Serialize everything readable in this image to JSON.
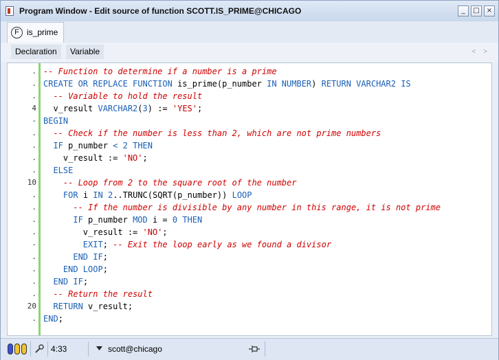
{
  "window": {
    "title": "Program Window - Edit source of function SCOTT.IS_PRIME@CHICAGO",
    "controls": {
      "minimize": "_",
      "maximize": "□",
      "close": "×"
    }
  },
  "tab": {
    "icon_letter": "F",
    "label": "is_prime"
  },
  "subtabs": [
    "Declaration",
    "Variable"
  ],
  "nav_arrows": "< >",
  "code_lines": [
    {
      "gutter": ".",
      "tokens": [
        {
          "t": "-- Function to determine if a number is a prime",
          "c": "cmt"
        }
      ]
    },
    {
      "gutter": ".",
      "tokens": [
        {
          "t": "CREATE OR REPLACE FUNCTION",
          "c": "kw"
        },
        {
          "t": " is_prime(p_number ",
          "c": ""
        },
        {
          "t": "IN NUMBER",
          "c": "kw"
        },
        {
          "t": ") ",
          "c": ""
        },
        {
          "t": "RETURN VARCHAR2 IS",
          "c": "kw"
        }
      ]
    },
    {
      "gutter": ".",
      "tokens": [
        {
          "t": "  ",
          "c": ""
        },
        {
          "t": "-- Variable to hold the result",
          "c": "cmt"
        }
      ]
    },
    {
      "gutter": "4",
      "tokens": [
        {
          "t": "  v_result ",
          "c": ""
        },
        {
          "t": "VARCHAR2",
          "c": "kw"
        },
        {
          "t": "(",
          "c": ""
        },
        {
          "t": "3",
          "c": "num"
        },
        {
          "t": ") := ",
          "c": ""
        },
        {
          "t": "'YES'",
          "c": "str"
        },
        {
          "t": ";",
          "c": ""
        }
      ]
    },
    {
      "gutter": "-",
      "tokens": [
        {
          "t": "BEGIN",
          "c": "kw"
        }
      ]
    },
    {
      "gutter": ".",
      "tokens": [
        {
          "t": "  ",
          "c": ""
        },
        {
          "t": "-- Check if the number is less than 2, which are not prime numbers",
          "c": "cmt"
        }
      ]
    },
    {
      "gutter": ".",
      "tokens": [
        {
          "t": "  ",
          "c": ""
        },
        {
          "t": "IF",
          "c": "kw"
        },
        {
          "t": " p_number ",
          "c": ""
        },
        {
          "t": "<",
          "c": "kw"
        },
        {
          "t": " ",
          "c": ""
        },
        {
          "t": "2",
          "c": "num"
        },
        {
          "t": " ",
          "c": ""
        },
        {
          "t": "THEN",
          "c": "kw"
        }
      ]
    },
    {
      "gutter": ".",
      "tokens": [
        {
          "t": "    v_result := ",
          "c": ""
        },
        {
          "t": "'NO'",
          "c": "str"
        },
        {
          "t": ";",
          "c": ""
        }
      ]
    },
    {
      "gutter": ".",
      "tokens": [
        {
          "t": "  ",
          "c": ""
        },
        {
          "t": "ELSE",
          "c": "kw"
        }
      ]
    },
    {
      "gutter": "10",
      "tokens": [
        {
          "t": "    ",
          "c": ""
        },
        {
          "t": "-- Loop from 2 to the square root of the number",
          "c": "cmt"
        }
      ]
    },
    {
      "gutter": ".",
      "tokens": [
        {
          "t": "    ",
          "c": ""
        },
        {
          "t": "FOR",
          "c": "kw"
        },
        {
          "t": " i ",
          "c": ""
        },
        {
          "t": "IN",
          "c": "kw"
        },
        {
          "t": " ",
          "c": ""
        },
        {
          "t": "2",
          "c": "num"
        },
        {
          "t": "..TRUNC(SQRT(p_number)) ",
          "c": ""
        },
        {
          "t": "LOOP",
          "c": "kw"
        }
      ]
    },
    {
      "gutter": ".",
      "tokens": [
        {
          "t": "      ",
          "c": ""
        },
        {
          "t": "-- If the number is divisible by any number in this range, it is not prime",
          "c": "cmt"
        }
      ]
    },
    {
      "gutter": ".",
      "tokens": [
        {
          "t": "      ",
          "c": ""
        },
        {
          "t": "IF",
          "c": "kw"
        },
        {
          "t": " p_number ",
          "c": ""
        },
        {
          "t": "MOD",
          "c": "kw"
        },
        {
          "t": " i = ",
          "c": ""
        },
        {
          "t": "0",
          "c": "num"
        },
        {
          "t": " ",
          "c": ""
        },
        {
          "t": "THEN",
          "c": "kw"
        }
      ]
    },
    {
      "gutter": ".",
      "tokens": [
        {
          "t": "        v_result := ",
          "c": ""
        },
        {
          "t": "'NO'",
          "c": "str"
        },
        {
          "t": ";",
          "c": ""
        }
      ]
    },
    {
      "gutter": "-",
      "tokens": [
        {
          "t": "        ",
          "c": ""
        },
        {
          "t": "EXIT",
          "c": "kw"
        },
        {
          "t": "; ",
          "c": ""
        },
        {
          "t": "-- Exit the loop early as we found a divisor",
          "c": "cmt"
        }
      ]
    },
    {
      "gutter": ".",
      "tokens": [
        {
          "t": "      ",
          "c": ""
        },
        {
          "t": "END IF",
          "c": "kw"
        },
        {
          "t": ";",
          "c": ""
        }
      ]
    },
    {
      "gutter": ".",
      "tokens": [
        {
          "t": "    ",
          "c": ""
        },
        {
          "t": "END LOOP",
          "c": "kw"
        },
        {
          "t": ";",
          "c": ""
        }
      ]
    },
    {
      "gutter": ".",
      "tokens": [
        {
          "t": "  ",
          "c": ""
        },
        {
          "t": "END IF",
          "c": "kw"
        },
        {
          "t": ";",
          "c": ""
        }
      ]
    },
    {
      "gutter": ".",
      "tokens": [
        {
          "t": "  ",
          "c": ""
        },
        {
          "t": "-- Return the result",
          "c": "cmt"
        }
      ]
    },
    {
      "gutter": "20",
      "tokens": [
        {
          "t": "  ",
          "c": ""
        },
        {
          "t": "RETURN",
          "c": "kw"
        },
        {
          "t": " v_result;",
          "c": ""
        }
      ]
    },
    {
      "gutter": ".",
      "tokens": [
        {
          "t": "END",
          "c": "kw"
        },
        {
          "t": ";",
          "c": ""
        }
      ]
    }
  ],
  "status": {
    "cylinder_colors": [
      "#3b4fd6",
      "#f2c230",
      "#f2c230"
    ],
    "cursor_position": "4:33",
    "connection": "scott@chicago",
    "dropdown_icon": "triangle-down-icon",
    "pin_icon": "pin-icon",
    "wrench_icon": "wrench-icon"
  },
  "colors": {
    "keyword": "#1a5fb4",
    "comment": "#d00000",
    "string": "#c40000",
    "gutter_bar": "#8ed36e"
  }
}
